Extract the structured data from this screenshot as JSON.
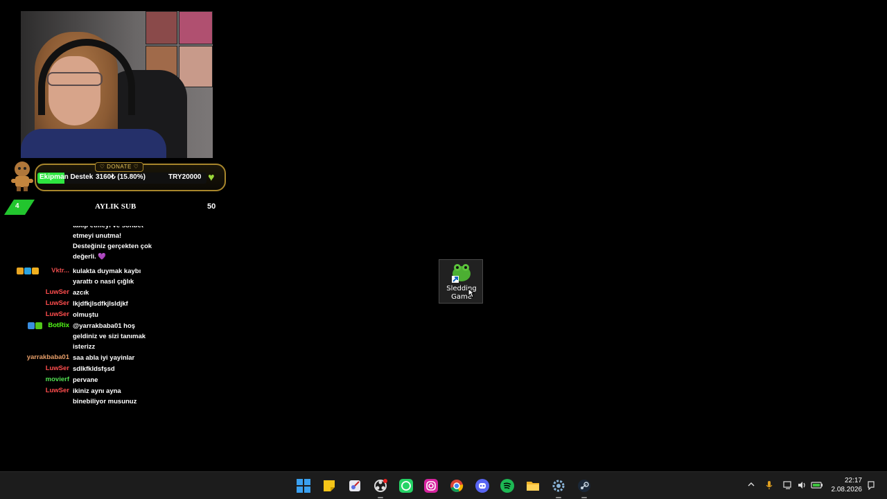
{
  "overlay": {
    "donate": {
      "tag": "♡ DONATE ♡",
      "donor": "Ekipman Destek",
      "amount": "3160₺ (15.80%)",
      "goal": "TRY20000",
      "progress_fraction": 0.158
    },
    "sub_goal": {
      "count": "4",
      "label": "AYLIK SUB",
      "goal": "50"
    }
  },
  "chat": [
    {
      "user": "",
      "user_color": "#ffffff",
      "badges": [],
      "message": "takip etmeyi ve sohbet etmeyi unutma! Desteğiniz gerçekten çok değerli. 💜"
    },
    {
      "user": "Vktr...",
      "user_color": "#e64b4b",
      "badges": [
        "crown",
        "gift",
        "bits"
      ],
      "message": "kulakta duymak kaybı yarattı o nasıl çığlık"
    },
    {
      "user": "LuwSer",
      "user_color": "#ff4d4d",
      "badges": [],
      "message": "azcık"
    },
    {
      "user": "LuwSer",
      "user_color": "#ff4d4d",
      "badges": [],
      "message": "lkjdfkjlsdfkjlsldjkf"
    },
    {
      "user": "LuwSer",
      "user_color": "#ff4d4d",
      "badges": [],
      "message": "olmuştu"
    },
    {
      "user": "BotRix",
      "user_color": "#53fc18",
      "badges": [
        "bot",
        "verified"
      ],
      "message": "@yarrakbaba01 hoş geldiniz ve sizi tanımak isterizz"
    },
    {
      "user": "yarrakbaba01",
      "user_color": "#e9a06a",
      "badges": [],
      "message": "saa abla iyi yayinlar"
    },
    {
      "user": "LuwSer",
      "user_color": "#ff4d4d",
      "badges": [],
      "message": "sdlkfkldsfşsd"
    },
    {
      "user": "movierf",
      "user_color": "#52e052",
      "badges": [],
      "message": "pervane"
    },
    {
      "user": "LuwSer",
      "user_color": "#ff4d4d",
      "badges": [],
      "message": "ikiniz aynı ayna binebiliyor musunuz"
    }
  ],
  "desktop": {
    "icon_label": "Sledding Game",
    "icon_name": "frog-shortcut-icon"
  },
  "taskbar": {
    "apps": [
      "start",
      "sticky-notes",
      "snipping-tool",
      "obs",
      "whatsapp",
      "instagram",
      "chrome",
      "discord",
      "spotify",
      "file-explorer",
      "settings",
      "steam"
    ],
    "clock_time": "22:17",
    "clock_date": "2.08.2026"
  }
}
